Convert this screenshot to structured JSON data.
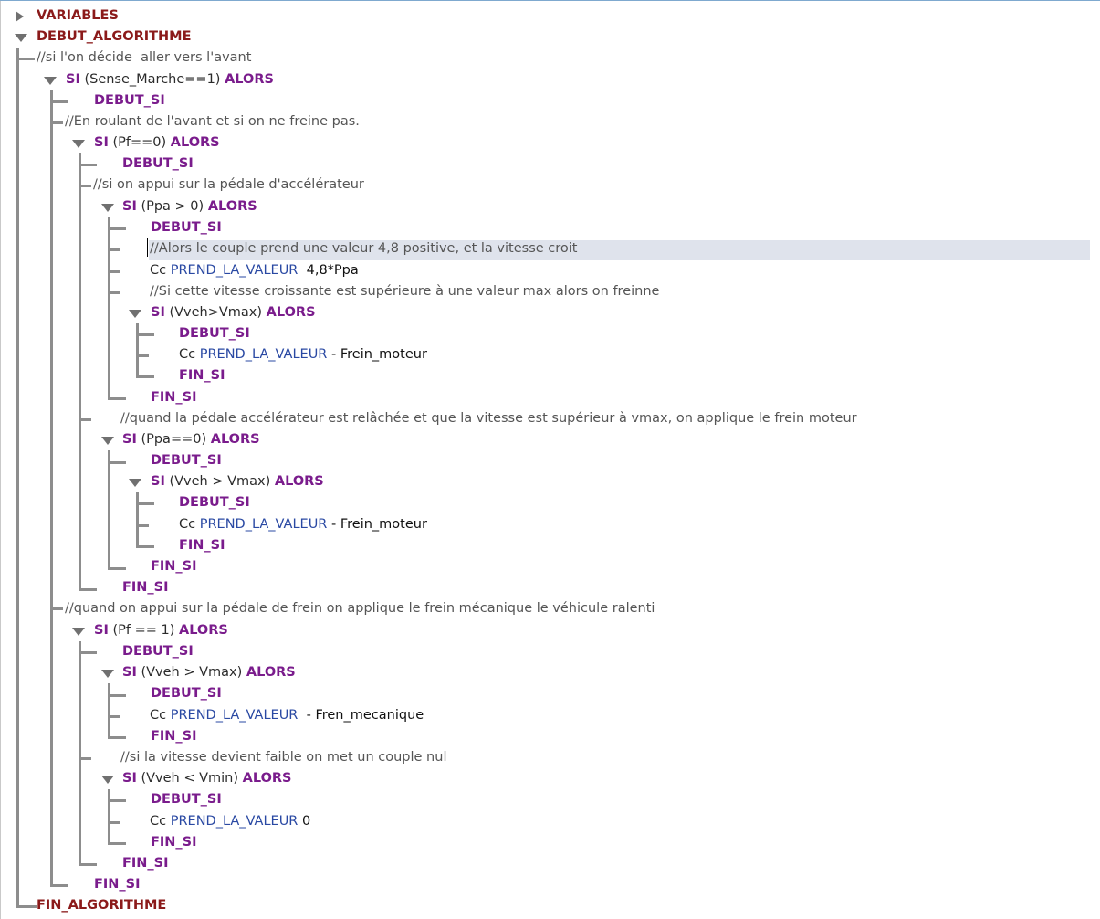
{
  "tree": {
    "variables": "VARIABLES",
    "debut_algorithme": "DEBUT_ALGORITHME",
    "fin_algorithme": "FIN_ALGORITHME",
    "kw_si": "SI",
    "kw_alors": "ALORS",
    "kw_debut_si": "DEBUT_SI",
    "kw_fin_si": "FIN_SI",
    "prend_la_valeur": "PREND_LA_VALEUR",
    "var_cc": "Cc",
    "cond_sense": "(Sense_Marche==1)",
    "cond_pf0": "(Pf==0)",
    "cond_ppa_pos": "(Ppa > 0)",
    "cond_vmax1": "(Vveh>Vmax)",
    "cond_ppa0": "(Ppa==0)",
    "cond_vmax2": "(Vveh > Vmax)",
    "cond_pf1": "(Pf == 1)",
    "cond_vmax3": "(Vveh > Vmax)",
    "cond_vmin": "(Vveh < Vmin)",
    "comment_1": "//si l'on décide  aller vers l'avant",
    "comment_2": "//En roulant de l'avant et si on ne freine pas.",
    "comment_3": "//si on appui sur la pédale d'accélérateur",
    "comment_4": "//Alors le couple prend une valeur 4,8 positive, et la vitesse croit",
    "comment_5": "//Si cette vitesse croissante est supérieure à une valeur max alors on freinne",
    "comment_6": "//quand la pédale accélérateur est relâchée et que la vitesse est supérieur à vmax, on applique le frein moteur",
    "comment_7": "//quand on appui sur la pédale de frein on applique le frein mécanique le véhicule ralenti",
    "comment_8": "//si la vitesse devient faible on met un couple nul",
    "val_ppa": "4,8*Ppa",
    "val_frein_moteur": "- Frein_moteur",
    "val_fren_mecanique": "- Fren_mecanique",
    "val_zero": "0"
  },
  "colors": {
    "keyword_red": "#8b1a1a",
    "keyword_purple": "#7a1c8c",
    "command_blue": "#2a49a3",
    "tree_line": "#8d8d8d",
    "highlight_row": "#dfe3ec"
  },
  "icons": {
    "collapsed": "triangle-right-icon",
    "expanded": "triangle-down-icon"
  }
}
